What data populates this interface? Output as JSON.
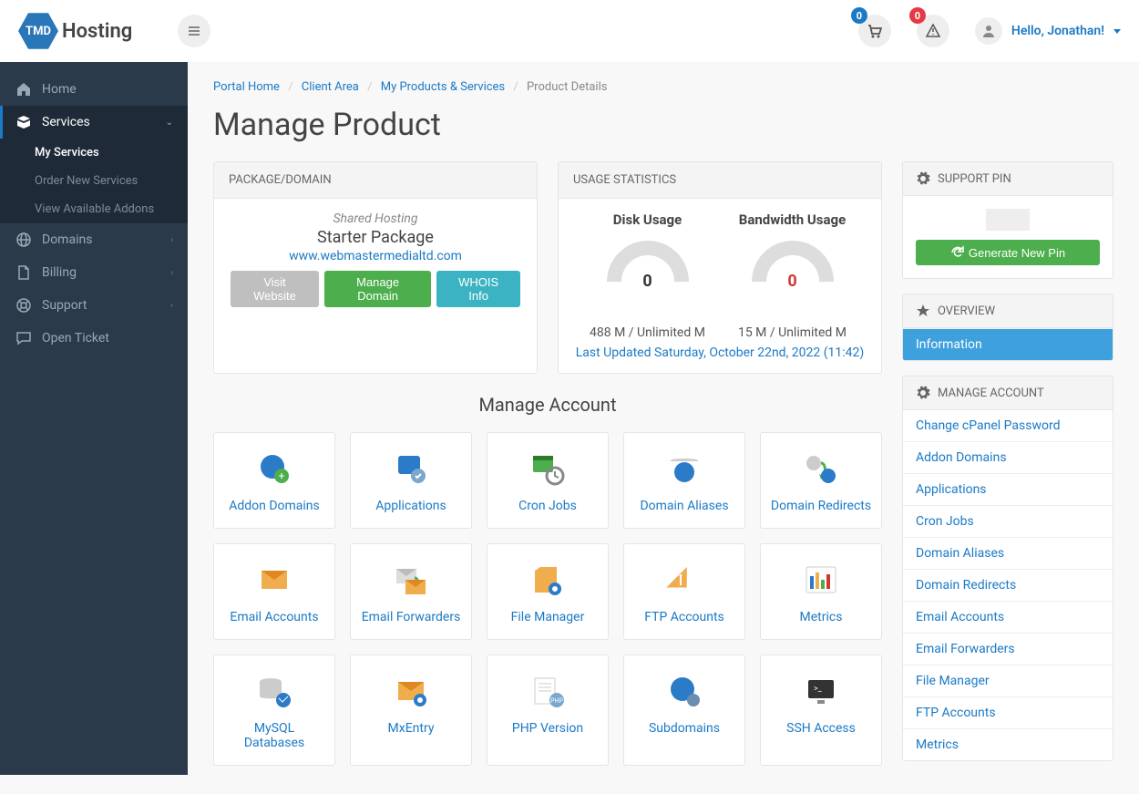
{
  "header": {
    "logo_badge": "TMD",
    "logo_text": "Hosting",
    "cart_count": "0",
    "alert_count": "0",
    "greeting": "Hello, Jonathan!"
  },
  "sidebar": {
    "items": [
      {
        "label": "Home"
      },
      {
        "label": "Services",
        "active": true,
        "sub": [
          {
            "label": "My Services",
            "active": true
          },
          {
            "label": "Order New Services"
          },
          {
            "label": "View Available Addons"
          }
        ]
      },
      {
        "label": "Domains"
      },
      {
        "label": "Billing"
      },
      {
        "label": "Support"
      },
      {
        "label": "Open Ticket"
      }
    ]
  },
  "breadcrumbs": {
    "home": "Portal Home",
    "client": "Client Area",
    "products": "My Products & Services",
    "current": "Product Details"
  },
  "page_title": "Manage Product",
  "package": {
    "header": "PACKAGE/DOMAIN",
    "type": "Shared Hosting",
    "name": "Starter Package",
    "domain": "www.webmastermedialtd.com",
    "visit_btn": "Visit Website",
    "manage_btn": "Manage Domain",
    "whois_btn": "WHOIS Info"
  },
  "usage": {
    "header": "USAGE STATISTICS",
    "disk_title": "Disk Usage",
    "bw_title": "Bandwidth Usage",
    "disk_value": "0",
    "bw_value": "0",
    "disk_detail": "488 M / Unlimited M",
    "bw_detail": "15 M / Unlimited M",
    "updated": "Last Updated Saturday, October 22nd, 2022 (11:42)"
  },
  "manage_section_title": "Manage Account",
  "tiles": [
    {
      "label": "Addon Domains"
    },
    {
      "label": "Applications"
    },
    {
      "label": "Cron Jobs"
    },
    {
      "label": "Domain Aliases"
    },
    {
      "label": "Domain Redirects"
    },
    {
      "label": "Email Accounts"
    },
    {
      "label": "Email Forwarders"
    },
    {
      "label": "File Manager"
    },
    {
      "label": "FTP Accounts"
    },
    {
      "label": "Metrics"
    },
    {
      "label": "MySQL Databases"
    },
    {
      "label": "MxEntry"
    },
    {
      "label": "PHP Version"
    },
    {
      "label": "Subdomains"
    },
    {
      "label": "SSH Access"
    }
  ],
  "support_pin": {
    "header": "SUPPORT PIN",
    "generate": "Generate New Pin"
  },
  "overview": {
    "header": "OVERVIEW",
    "information": "Information"
  },
  "manage_account": {
    "header": "MANAGE ACCOUNT",
    "items": [
      "Change cPanel Password",
      "Addon Domains",
      "Applications",
      "Cron Jobs",
      "Domain Aliases",
      "Domain Redirects",
      "Email Accounts",
      "Email Forwarders",
      "File Manager",
      "FTP Accounts",
      "Metrics"
    ]
  }
}
